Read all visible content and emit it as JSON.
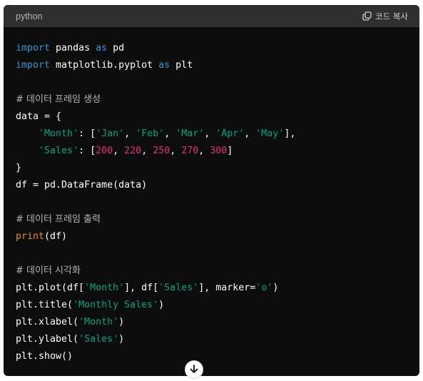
{
  "code_block": {
    "language": "python",
    "copy_label": "코드 복사",
    "lines": {
      "l1": [
        "import",
        " pandas ",
        "as",
        " pd"
      ],
      "l2": [
        "import",
        " matplotlib.pyplot ",
        "as",
        " plt"
      ],
      "l4": "# 데이터 프레임 생성",
      "l5": "data = {",
      "l6": [
        "    ",
        "'Month'",
        ": [",
        "'Jan'",
        ", ",
        "'Feb'",
        ", ",
        "'Mar'",
        ", ",
        "'Apr'",
        ", ",
        "'May'",
        "],"
      ],
      "l7": [
        "    ",
        "'Sales'",
        ": [",
        "200",
        ", ",
        "220",
        ", ",
        "250",
        ", ",
        "270",
        ", ",
        "300",
        "]"
      ],
      "l8": "}",
      "l9": "df = pd.DataFrame(data)",
      "l11": "# 데이터 프레임 출력",
      "l12": [
        "print",
        "(df)"
      ],
      "l14": "# 데이터 시각화",
      "l15": [
        "plt.plot(df[",
        "'Month'",
        "], df[",
        "'Sales'",
        "], marker=",
        "'o'",
        ")"
      ],
      "l16": [
        "plt.title(",
        "'Monthly Sales'",
        ")"
      ],
      "l17": [
        "plt.xlabel(",
        "'Month'",
        ")"
      ],
      "l18": [
        "plt.ylabel(",
        "'Sales'",
        ")"
      ],
      "l19": "plt.show()"
    }
  },
  "colors": {
    "background": "#0d0d0d",
    "header": "#2f2f2f",
    "keyword": "#2e95d3",
    "string": "#00a67d",
    "number": "#df3079",
    "builtin": "#e9950c",
    "comment": "#b4b4b4"
  },
  "icons": {
    "copy": "copy-icon",
    "scroll": "arrow-down-icon"
  }
}
